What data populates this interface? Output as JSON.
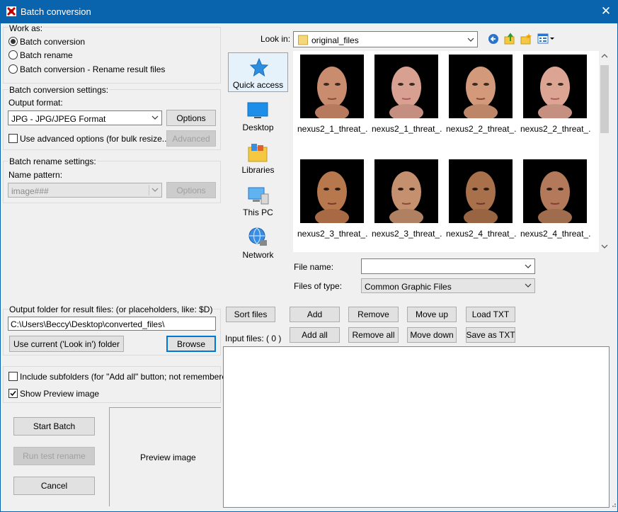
{
  "window": {
    "title": "Batch conversion",
    "close_glyph": "✕",
    "icon": "app-icon"
  },
  "work_as": {
    "label": "Work as:",
    "options": [
      {
        "label": "Batch conversion",
        "selected": true
      },
      {
        "label": "Batch rename",
        "selected": false
      },
      {
        "label": "Batch conversion - Rename result files",
        "selected": false
      }
    ]
  },
  "conversion_settings": {
    "label": "Batch conversion settings:",
    "output_format_label": "Output format:",
    "output_format_value": "JPG - JPG/JPEG Format",
    "options_button": "Options",
    "advanced_checkbox_label": "Use advanced options (for bulk resize...)",
    "advanced_checked": false,
    "advanced_button": "Advanced"
  },
  "rename_settings": {
    "label": "Batch rename settings:",
    "name_pattern_label": "Name pattern:",
    "name_pattern_value": "image###",
    "options_button": "Options"
  },
  "output_folder": {
    "label": "Output folder for result files: (or placeholders, like: $D)",
    "path": "C:\\Users\\Beccy\\Desktop\\converted_files\\",
    "use_current_button": "Use current ('Look in') folder",
    "browse_button": "Browse"
  },
  "options": {
    "include_subfolders_label": "Include subfolders (for \"Add all\" button; not remembered)",
    "include_subfolders_checked": false,
    "show_preview_label": "Show Preview image",
    "show_preview_checked": true
  },
  "actions": {
    "start_batch": "Start Batch",
    "run_test_rename": "Run test rename",
    "cancel": "Cancel"
  },
  "preview": {
    "label": "Preview image"
  },
  "browser": {
    "look_in_label": "Look in:",
    "look_in_value": "original_files",
    "places": [
      {
        "label": "Quick access",
        "icon": "star-icon"
      },
      {
        "label": "Desktop",
        "icon": "desktop-icon"
      },
      {
        "label": "Libraries",
        "icon": "libraries-icon"
      },
      {
        "label": "This PC",
        "icon": "this-pc-icon"
      },
      {
        "label": "Network",
        "icon": "network-icon"
      }
    ],
    "files": [
      "nexus2_1_threat_...",
      "nexus2_1_threat_...",
      "nexus2_2_threat_...",
      "nexus2_2_threat_...",
      "nexus2_3_threat_...",
      "nexus2_3_threat_...",
      "nexus2_4_threat_...",
      "nexus2_4_threat_..."
    ],
    "file_name_label": "File name:",
    "file_name_value": "",
    "files_of_type_label": "Files of type:",
    "files_of_type_value": "Common Graphic Files"
  },
  "input_files": {
    "sort_files": "Sort files",
    "add": "Add",
    "add_all": "Add all",
    "remove": "Remove",
    "remove_all": "Remove all",
    "move_up": "Move up",
    "move_down": "Move down",
    "load_txt": "Load TXT",
    "save_as_txt": "Save as TXT",
    "label": "Input files: ( 0 )"
  },
  "colors": {
    "titlebar": "#0a64ad",
    "window_bg": "#f0f0f0",
    "focus": "#0078d7"
  }
}
